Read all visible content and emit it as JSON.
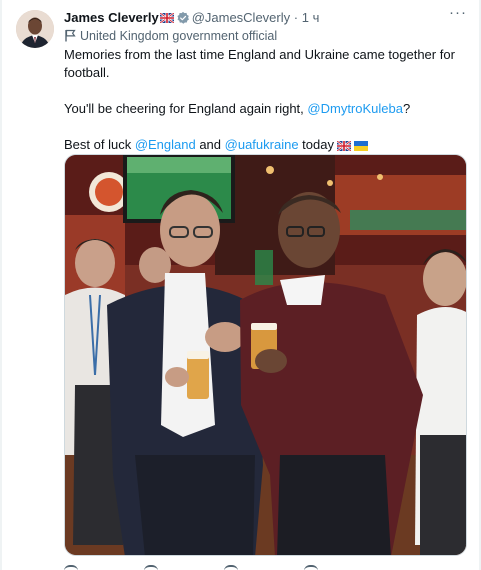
{
  "tweet": {
    "author_name": "James Cleverly",
    "author_handle": "@JamesCleverly",
    "separator": "·",
    "timestamp": "1 ч",
    "more_label": "···",
    "affiliation": "United Kingdom government official",
    "text": {
      "line1": "Memories from the last time England and Ukraine came together for football.",
      "line2_prefix": "You'll be cheering for England again right, ",
      "line2_mention": "@DmytroKuleba",
      "line2_suffix": "?",
      "line3_prefix": "Best of luck ",
      "line3_mention1": "@England",
      "line3_mid": " and ",
      "line3_mention2": "@uafukraine",
      "line3_suffix": " today"
    }
  },
  "colors": {
    "link": "#1d9bf0",
    "verified": "#829aab",
    "secondary_text": "#536471"
  },
  "icons": {
    "verified": "verified-badge-icon",
    "affiliation": "government-flag-icon",
    "more": "more-icon",
    "uk_flag": "uk-flag-emoji",
    "ukraine_flag": "ukraine-flag-emoji"
  }
}
